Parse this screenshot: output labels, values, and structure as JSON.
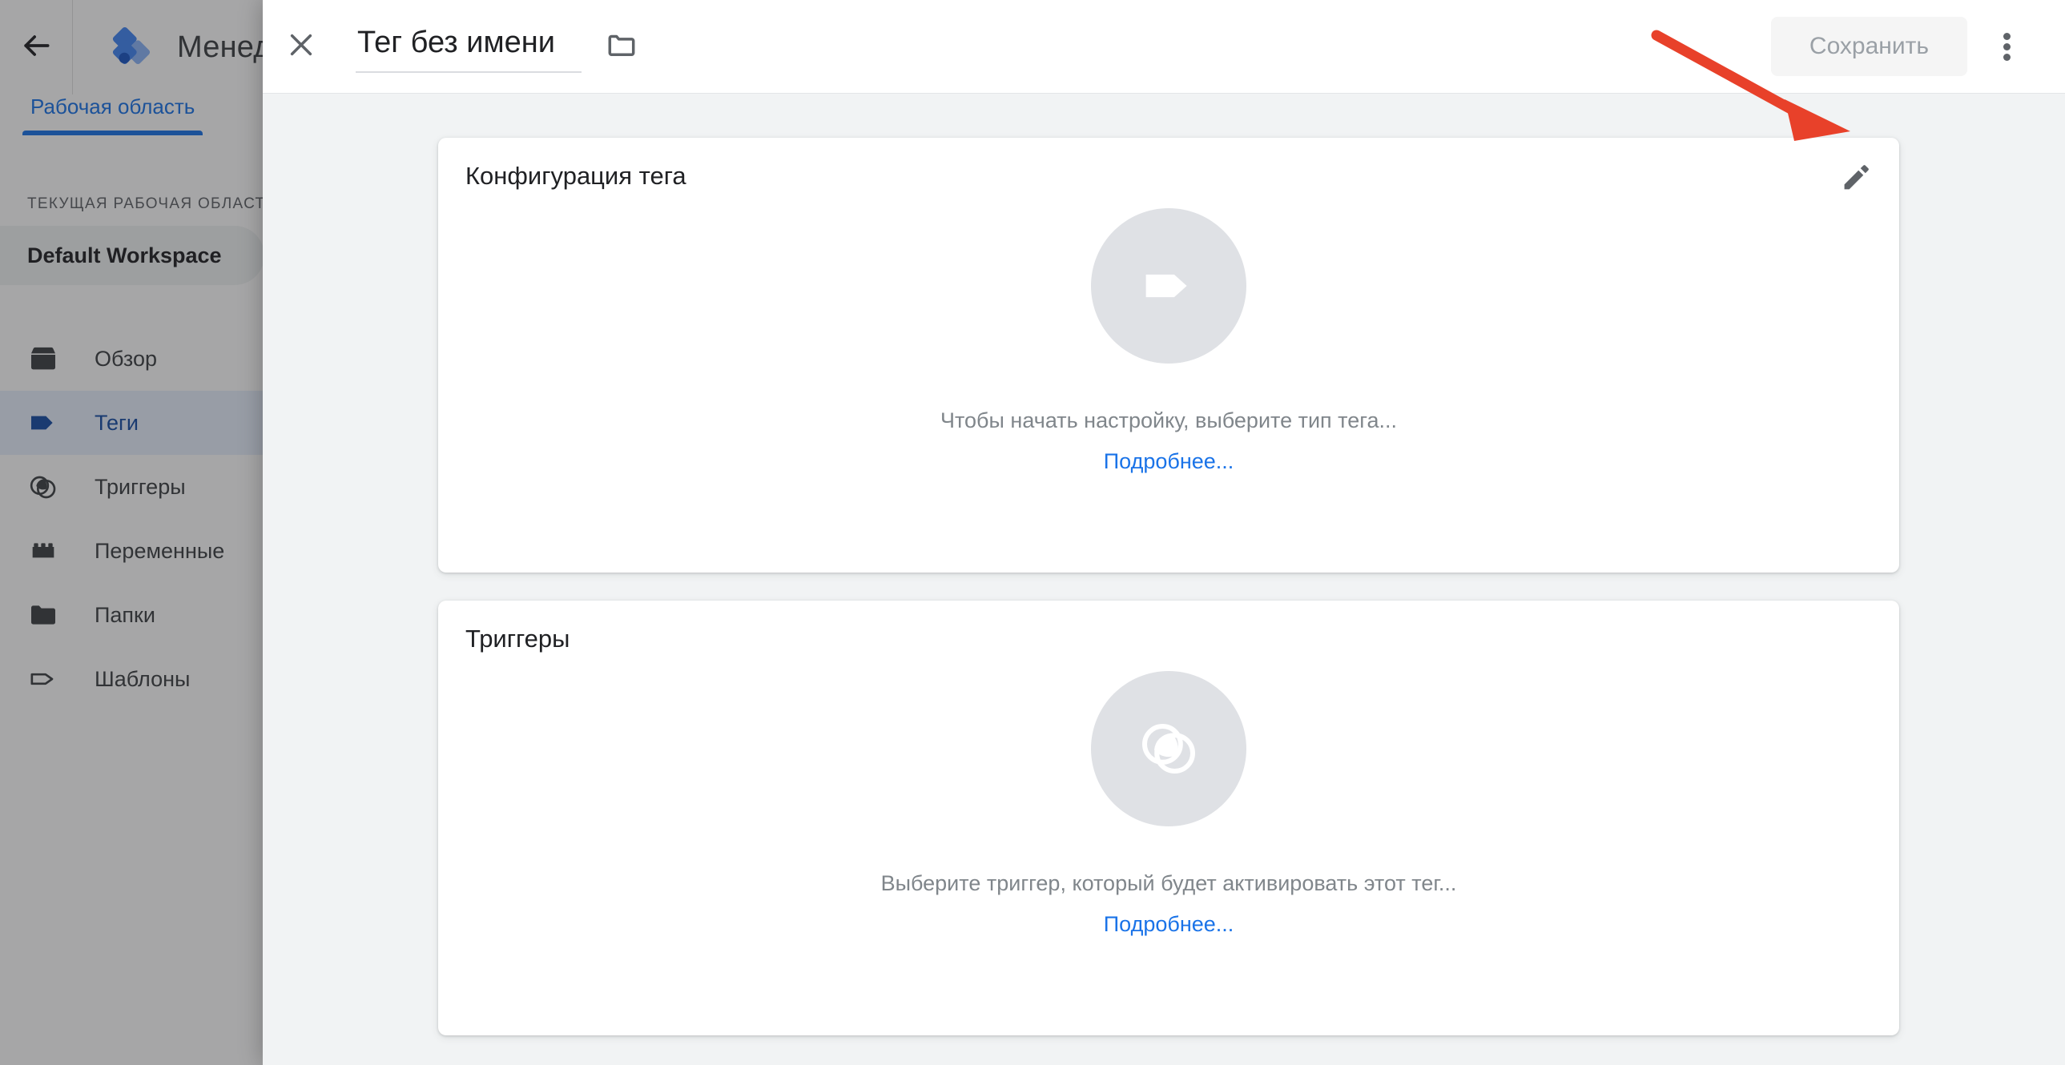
{
  "app": {
    "back_icon": "arrow-left-icon",
    "logo_icon": "gtm-logo-icon",
    "title": "Менеджер тегов",
    "workspace_tab": "Рабочая область",
    "current_workspace_label": "ТЕКУЩАЯ РАБОЧАЯ ОБЛАСТЬ",
    "current_workspace_name": "Default Workspace",
    "nav": [
      {
        "label": "Обзор",
        "icon": "overview-box-icon",
        "active": false
      },
      {
        "label": "Теги",
        "icon": "tag-filled-icon",
        "active": true
      },
      {
        "label": "Триггеры",
        "icon": "trigger-circles-icon",
        "active": false
      },
      {
        "label": "Переменные",
        "icon": "variables-brick-icon",
        "active": false
      },
      {
        "label": "Папки",
        "icon": "folder-filled-icon",
        "active": false
      },
      {
        "label": "Шаблоны",
        "icon": "template-tag-outline-icon",
        "active": false
      }
    ]
  },
  "modal": {
    "close_icon": "close-icon",
    "tag_name": "Тег без имени",
    "tag_name_placeholder": "Тег без имени",
    "folder_icon": "folder-outline-icon",
    "save_label": "Сохранить",
    "save_disabled": true,
    "more_icon": "more-vert-icon",
    "cards": [
      {
        "id": "config",
        "title": "Конфигурация тега",
        "edit_icon": "pencil-edit-icon",
        "placeholder_icon": "tag-placeholder-icon",
        "hint": "Чтобы начать настройку, выберите тип тега...",
        "link": "Подробнее..."
      },
      {
        "id": "triggers",
        "title": "Триггеры",
        "edit_icon": "",
        "placeholder_icon": "trigger-placeholder-icon",
        "hint": "Выберите триггер, который будет активировать этот тег...",
        "link": "Подробнее..."
      }
    ]
  },
  "annotation": {
    "type": "arrow",
    "color": "#e8412a",
    "points_to": "pencil-edit-icon"
  },
  "colors": {
    "accent_blue": "#1a73e8",
    "active_nav_bg": "#e8f0fe",
    "active_nav_text": "#174ea6",
    "body_bg": "#f1f3f4",
    "card_bg": "#ffffff",
    "placeholder_circle": "#dfe1e5",
    "hint_text": "#80868b",
    "annotation_red": "#e8412a"
  }
}
